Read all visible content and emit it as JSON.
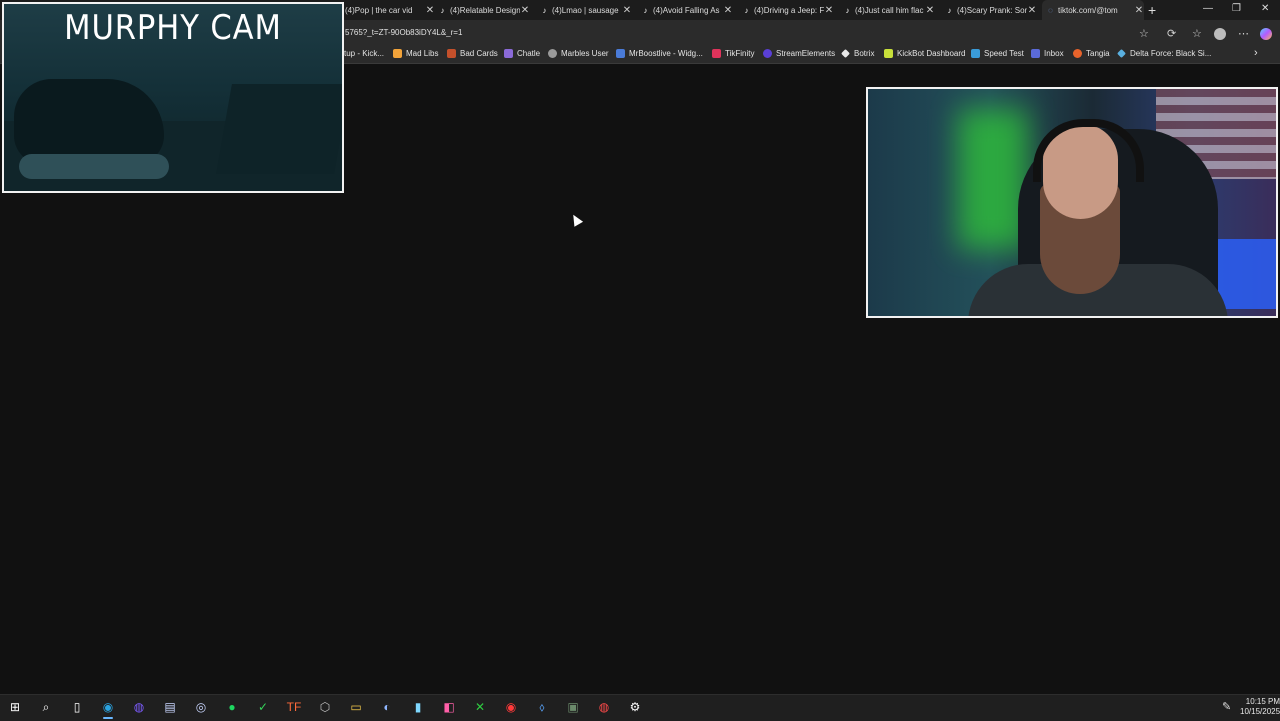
{
  "tabs": [
    {
      "title": "(4)Pop | the car vid",
      "active": false
    },
    {
      "title": "(4)Relatable Design",
      "active": false
    },
    {
      "title": "(4)Lmao | sausage",
      "active": false
    },
    {
      "title": "(4)Avoid Falling As",
      "active": false
    },
    {
      "title": "(4)Driving a Jeep: F",
      "active": false
    },
    {
      "title": "(4)Just call him flac",
      "active": false
    },
    {
      "title": "(4)Scary Prank: Son",
      "active": false
    },
    {
      "title": "tiktok.com/@tom",
      "active": true
    }
  ],
  "url": "5765?_t=ZT-90Ob83iDY4L&_r=1",
  "bookmarks": [
    {
      "label": "tup - Kick...",
      "color": "#2b2b2b"
    },
    {
      "label": "Mad Libs",
      "color": "#f2a33a"
    },
    {
      "label": "Bad Cards",
      "color": "#c4502b"
    },
    {
      "label": "Chatle",
      "color": "#8b6ad8"
    },
    {
      "label": "Marbles User",
      "color": "#9a9a9a"
    },
    {
      "label": "MrBoostlive - Widg...",
      "color": "#4a7bd8"
    },
    {
      "label": "TikFinity",
      "color": "#e0335b"
    },
    {
      "label": "StreamElements",
      "color": "#5a3fd6"
    },
    {
      "label": "Botrix",
      "color": "#e8e8e8"
    },
    {
      "label": "KickBot Dashboard",
      "color": "#c8e03a"
    },
    {
      "label": "Speed Test",
      "color": "#3a9bd8"
    },
    {
      "label": "Inbox",
      "color": "#5a6ad8"
    },
    {
      "label": "Tangia",
      "color": "#e8632b"
    },
    {
      "label": "Delta Force: Black Si...",
      "color": "#5ab0e0"
    }
  ],
  "murphy_cam": {
    "title": "MURPHY CAM"
  },
  "clock": {
    "time": "10:15 PM",
    "date": "10/15/2025"
  },
  "icons": {
    "close": "✕",
    "new_tab": "+",
    "minimize": "—",
    "maximize": "❐",
    "window_close": "✕",
    "star": "☆",
    "refresh": "⟳",
    "favorites": "☆",
    "more": "⋯",
    "chevron": "›",
    "tiktok": "♪"
  },
  "taskbar": [
    {
      "name": "start",
      "glyph": "⊞",
      "color": "#ffffff"
    },
    {
      "name": "search",
      "glyph": "⌕",
      "color": "#ffffff"
    },
    {
      "name": "task-view",
      "glyph": "▯",
      "color": "#ffffff"
    },
    {
      "name": "edge",
      "glyph": "◉",
      "color": "#2aa3e0",
      "active": true
    },
    {
      "name": "chrome",
      "glyph": "◍",
      "color": "#7d5cff"
    },
    {
      "name": "app1",
      "glyph": "▤",
      "color": "#c9d6ff"
    },
    {
      "name": "app2",
      "glyph": "◎",
      "color": "#c9d6ff"
    },
    {
      "name": "spotify",
      "glyph": "●",
      "color": "#1ed760"
    },
    {
      "name": "app3",
      "glyph": "✓",
      "color": "#35d35a"
    },
    {
      "name": "app4",
      "glyph": "TF",
      "color": "#ff6a3a"
    },
    {
      "name": "obs",
      "glyph": "⬡",
      "color": "#bfbfbf"
    },
    {
      "name": "files",
      "glyph": "▭",
      "color": "#f2c84b"
    },
    {
      "name": "app5",
      "glyph": "◐",
      "color": "#8fb6ff"
    },
    {
      "name": "notepad",
      "glyph": "▮",
      "color": "#7fd8ff"
    },
    {
      "name": "app6",
      "glyph": "◧",
      "color": "#ff5fa8"
    },
    {
      "name": "xbox",
      "glyph": "✕",
      "color": "#2ecc40"
    },
    {
      "name": "app7",
      "glyph": "◉",
      "color": "#ff3a3a"
    },
    {
      "name": "app8",
      "glyph": "⬨",
      "color": "#5aa6ff"
    },
    {
      "name": "app9",
      "glyph": "▣",
      "color": "#6b8a6b"
    },
    {
      "name": "app10",
      "glyph": "◍",
      "color": "#ff4a4a"
    },
    {
      "name": "settings",
      "glyph": "⚙",
      "color": "#ffffff"
    }
  ]
}
